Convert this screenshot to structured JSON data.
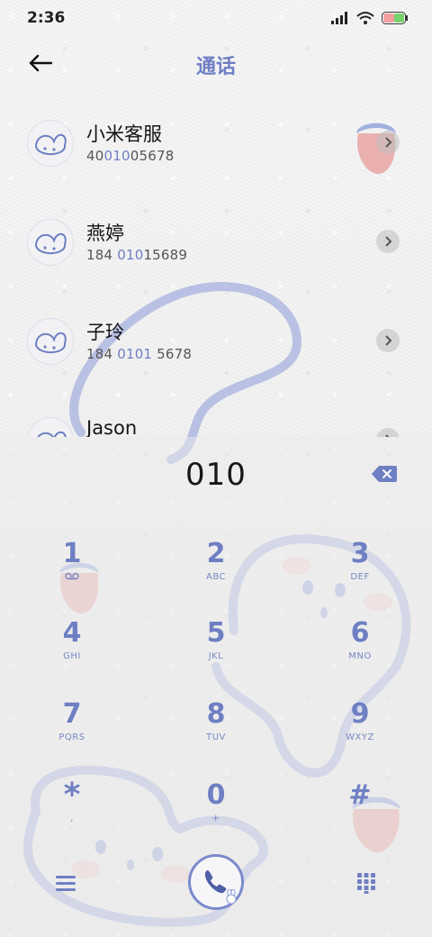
{
  "status_bar": {
    "time": "2:36",
    "battery_color": "#77d36b"
  },
  "header": {
    "title": "通话",
    "back_icon": "arrow-left-icon"
  },
  "contacts": [
    {
      "name": "小米客服",
      "number_parts": [
        "40",
        "010",
        "05678"
      ]
    },
    {
      "name": "燕婷",
      "number_parts": [
        "184 ",
        "010",
        "15689"
      ]
    },
    {
      "name": "子玲",
      "number_parts": [
        "184 ",
        "0101",
        " 5678"
      ]
    },
    {
      "name": "Jason",
      "number_parts": []
    }
  ],
  "dialer": {
    "input_value": "010",
    "keys": [
      {
        "digit": "1",
        "letters": ""
      },
      {
        "digit": "2",
        "letters": "ABC"
      },
      {
        "digit": "3",
        "letters": "DEF"
      },
      {
        "digit": "4",
        "letters": "GHI"
      },
      {
        "digit": "5",
        "letters": "JKL"
      },
      {
        "digit": "6",
        "letters": "MNO"
      },
      {
        "digit": "7",
        "letters": "PQRS"
      },
      {
        "digit": "8",
        "letters": "TUV"
      },
      {
        "digit": "9",
        "letters": "WXYZ"
      },
      {
        "digit": "*",
        "letters": ","
      },
      {
        "digit": "0",
        "letters": "+"
      },
      {
        "digit": "#",
        "letters": ""
      }
    ]
  },
  "colors": {
    "accent": "#6f7fc3",
    "highlight": "#6f7fc3",
    "strawberry": "#e58a8a"
  }
}
